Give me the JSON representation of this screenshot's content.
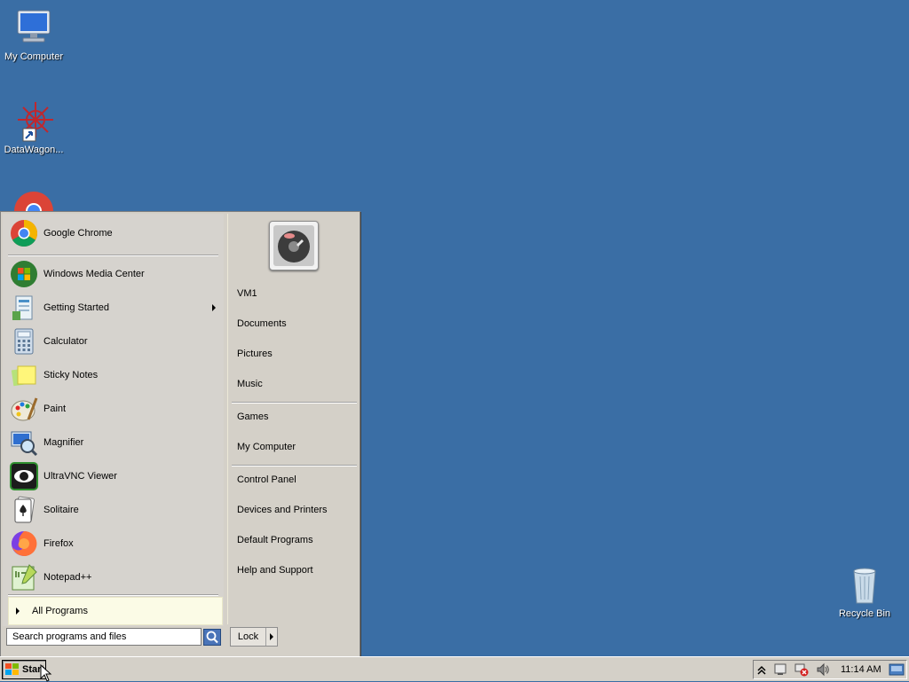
{
  "desktop": {
    "icons": [
      {
        "label": "My Computer"
      },
      {
        "label": "DataWagon..."
      },
      {
        "label": "Recycle Bin"
      }
    ]
  },
  "start_menu": {
    "pinned": [
      {
        "label": "Google Chrome",
        "icon": "chrome-icon"
      }
    ],
    "recent": [
      {
        "label": "Windows Media Center",
        "icon": "windows-media-center-icon"
      },
      {
        "label": "Getting Started",
        "icon": "getting-started-icon",
        "has_submenu": true
      },
      {
        "label": "Calculator",
        "icon": "calculator-icon"
      },
      {
        "label": "Sticky Notes",
        "icon": "sticky-notes-icon"
      },
      {
        "label": "Paint",
        "icon": "paint-icon"
      },
      {
        "label": "Magnifier",
        "icon": "magnifier-icon"
      },
      {
        "label": "UltraVNC Viewer",
        "icon": "ultravnc-viewer-icon"
      },
      {
        "label": "Solitaire",
        "icon": "solitaire-icon"
      },
      {
        "label": "Firefox",
        "icon": "firefox-icon"
      },
      {
        "label": "Notepad++",
        "icon": "notepad-plus-plus-icon"
      }
    ],
    "all_programs": "All Programs",
    "search_placeholder": "Search programs and files",
    "right_items": [
      {
        "label": "VM1"
      },
      {
        "label": "Documents"
      },
      {
        "label": "Pictures"
      },
      {
        "label": "Music"
      },
      {
        "label": "Games"
      },
      {
        "label": "My Computer"
      },
      {
        "label": "Control Panel"
      },
      {
        "label": "Devices and Printers"
      },
      {
        "label": "Default Programs"
      },
      {
        "label": "Help and Support"
      }
    ],
    "lock_label": "Lock"
  },
  "taskbar": {
    "start_label": "Start",
    "clock": "11:14 AM"
  },
  "colors": {
    "desktop_background": "#3a6ea5",
    "menu_background": "#d4d0c8",
    "all_programs_background": "#fbfbe6"
  }
}
